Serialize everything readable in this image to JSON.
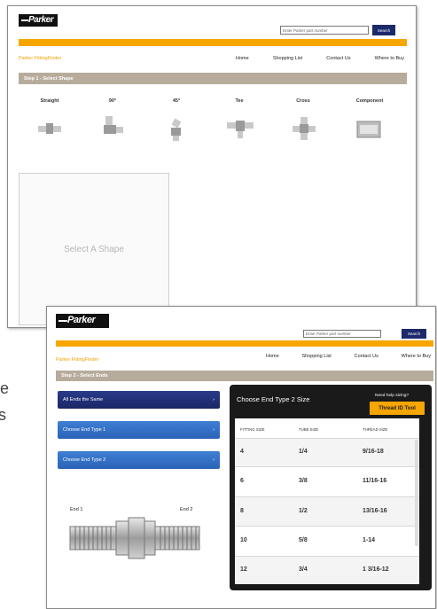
{
  "left_text_fragments": [
    "re",
    "s"
  ],
  "window1": {
    "logo": "Parker",
    "search": {
      "placeholder": "Enter Parker part number",
      "button": "Search"
    },
    "brand_link": "Parker FittingFinder",
    "nav": [
      "Home",
      "Shopping List",
      "Contact Us",
      "Where to Buy"
    ],
    "step": "Step 1 - Select Shape",
    "shapes": [
      "Straight",
      "90°",
      "45°",
      "Tee",
      "Cross",
      "Component"
    ],
    "shape_icons": [
      "straight-fitting-icon",
      "elbow-90-fitting-icon",
      "elbow-45-fitting-icon",
      "tee-fitting-icon",
      "cross-fitting-icon",
      "component-icon"
    ],
    "select_panel": "Select A Shape"
  },
  "window2": {
    "logo": "Parker",
    "search": {
      "placeholder": "Enter Parker part number",
      "button": "Search"
    },
    "brand_link": "Parker FittingFinder",
    "nav": [
      "Home",
      "Shopping List",
      "Contact Us",
      "Where to Buy"
    ],
    "step": "Step 2 - Select Ends",
    "end_buttons": [
      "All Ends the Same",
      "Choose End Type 1",
      "Choose End Type 2"
    ],
    "end_labels": [
      "End 1",
      "End 2"
    ],
    "size_panel": {
      "title": "Choose End Type 2 Size",
      "help": "Need help sizing?",
      "tool_button": "Thread ID Tool",
      "headers": [
        "FITTING SIZE",
        "TUBE SIZE",
        "THREAD SIZE"
      ],
      "rows": [
        [
          "4",
          "1/4",
          "9/16-18"
        ],
        [
          "6",
          "3/8",
          "11/16-16"
        ],
        [
          "8",
          "1/2",
          "13/16-16"
        ],
        [
          "10",
          "5/8",
          "1-14"
        ],
        [
          "12",
          "3/4",
          "1 3/16-12"
        ]
      ]
    }
  },
  "colors": {
    "accent_orange": "#f7a600",
    "navy": "#1c2a6b",
    "step_bar": "#b7ab9b",
    "end_type_blue": "#2f6fc6"
  }
}
